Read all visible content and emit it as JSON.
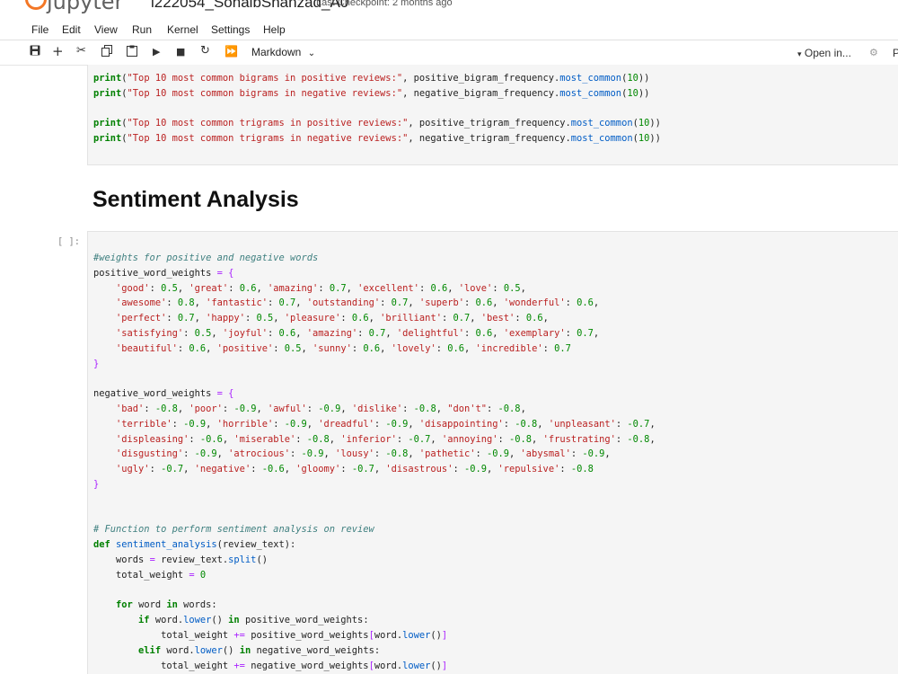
{
  "app": {
    "logo_text": "jupyter",
    "notebook_title": "i222054_SohaibShahzad_A0",
    "checkpoint": "Last Checkpoint: 2 months ago"
  },
  "menu": [
    "File",
    "Edit",
    "View",
    "Run",
    "Kernel",
    "Settings",
    "Help"
  ],
  "toolbar": {
    "icons": [
      "save-icon",
      "add-cell-icon",
      "cut-icon",
      "copy-icon",
      "paste-icon",
      "run-icon",
      "stop-icon",
      "restart-icon",
      "fast-forward-icon"
    ],
    "cell_type": "Markdown",
    "open_in": "Open in...",
    "trailing": "P"
  },
  "cells": {
    "top_code": {
      "lines": [
        "print(\"Top 10 most common bigrams in positive reviews:\", positive_bigram_frequency.most_common(10))",
        "print(\"Top 10 most common bigrams in negative reviews:\", negative_bigram_frequency.most_common(10))",
        "",
        "print(\"Top 10 most common trigrams in positive reviews:\", positive_trigram_frequency.most_common(10))",
        "print(\"Top 10 most common trigrams in negative reviews:\", negative_trigram_frequency.most_common(10))"
      ]
    },
    "markdown_heading": "Sentiment Analysis",
    "main_code": {
      "prompt": "[ ]:",
      "lines": [
        "#weights for positive and negative words",
        "positive_word_weights = {",
        "    'good': 0.5, 'great': 0.6, 'amazing': 0.7, 'excellent': 0.6, 'love': 0.5,",
        "    'awesome': 0.8, 'fantastic': 0.7, 'outstanding': 0.7, 'superb': 0.6, 'wonderful': 0.6,",
        "    'perfect': 0.7, 'happy': 0.5, 'pleasure': 0.6, 'brilliant': 0.7, 'best': 0.6,",
        "    'satisfying': 0.5, 'joyful': 0.6, 'amazing': 0.7, 'delightful': 0.6, 'exemplary': 0.7,",
        "    'beautiful': 0.6, 'positive': 0.5, 'sunny': 0.6, 'lovely': 0.6, 'incredible': 0.7",
        "}",
        "",
        "negative_word_weights = {",
        "    'bad': -0.8, 'poor': -0.9, 'awful': -0.9, 'dislike': -0.8, \"don't\": -0.8,",
        "    'terrible': -0.9, 'horrible': -0.9, 'dreadful': -0.9, 'disappointing': -0.8, 'unpleasant': -0.7,",
        "    'displeasing': -0.6, 'miserable': -0.8, 'inferior': -0.7, 'annoying': -0.8, 'frustrating': -0.8,",
        "    'disgusting': -0.9, 'atrocious': -0.9, 'lousy': -0.8, 'pathetic': -0.9, 'abysmal': -0.9,",
        "    'ugly': -0.7, 'negative': -0.6, 'gloomy': -0.7, 'disastrous': -0.9, 'repulsive': -0.8",
        "}",
        "",
        "",
        "# Function to perform sentiment analysis on review",
        "def sentiment_analysis(review_text):",
        "    words = review_text.split()",
        "    total_weight = 0",
        "",
        "    for word in words:",
        "        if word.lower() in positive_word_weights:",
        "            total_weight += positive_word_weights[word.lower()]",
        "        elif word.lower() in negative_word_weights:",
        "            total_weight += negative_word_weights[word.lower()]"
      ]
    }
  },
  "colors": {
    "jupyter_orange": "#F37726",
    "keyword": "#008000",
    "string": "#BA2121",
    "comment": "#408080",
    "cell_bg": "#F5F5F5"
  }
}
